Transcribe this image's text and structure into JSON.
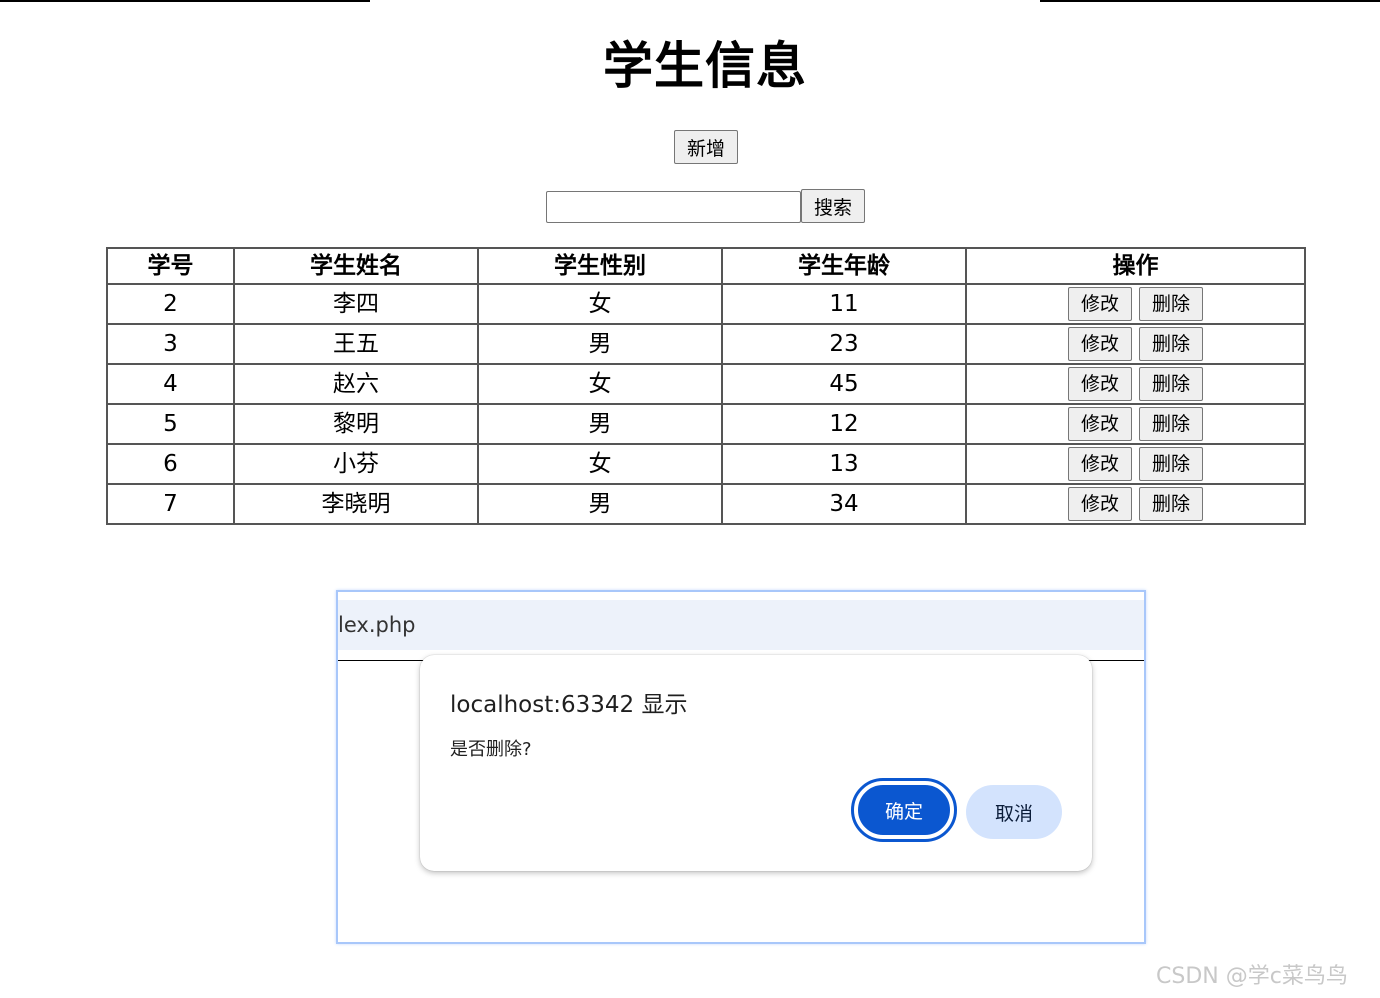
{
  "page": {
    "title": "学生信息",
    "add_label": "新增",
    "search_placeholder": "",
    "search_label": "搜索"
  },
  "table": {
    "headers": [
      "学号",
      "学生姓名",
      "学生性别",
      "学生年龄",
      "操作"
    ],
    "rows": [
      {
        "id": "2",
        "name": "李四",
        "gender": "女",
        "age": "11"
      },
      {
        "id": "3",
        "name": "王五",
        "gender": "男",
        "age": "23"
      },
      {
        "id": "4",
        "name": "赵六",
        "gender": "女",
        "age": "45"
      },
      {
        "id": "5",
        "name": "黎明",
        "gender": "男",
        "age": "12"
      },
      {
        "id": "6",
        "name": "小芬",
        "gender": "女",
        "age": "13"
      },
      {
        "id": "7",
        "name": "李晓明",
        "gender": "男",
        "age": "34"
      }
    ],
    "edit_label": "修改",
    "delete_label": "删除"
  },
  "browser": {
    "tab_text": "lex.php"
  },
  "dialog": {
    "title": "localhost:63342 显示",
    "message": "是否删除?",
    "confirm_label": "确定",
    "cancel_label": "取消",
    "confirm_color": "#0b57d0",
    "cancel_color": "#d3e3fd"
  },
  "watermark": "CSDN @学c菜鸟鸟"
}
